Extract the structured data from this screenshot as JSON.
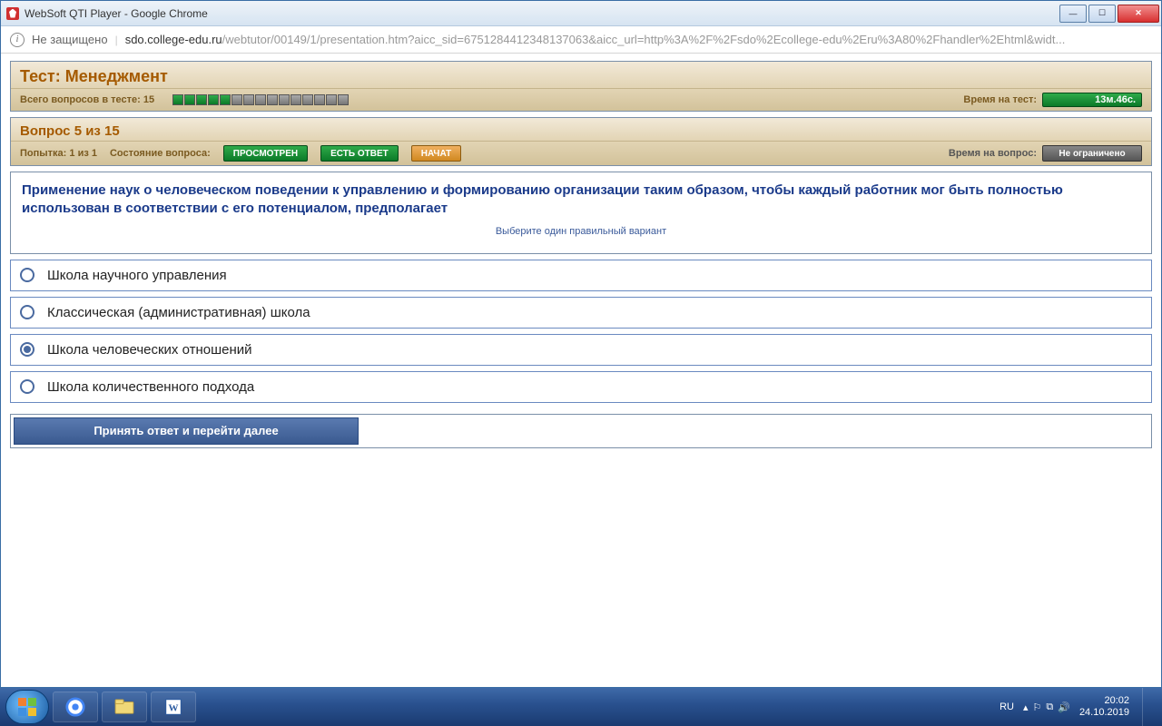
{
  "window": {
    "title": "WebSoft QTI Player - Google Chrome"
  },
  "address": {
    "not_secure": "Не защищено",
    "host": "sdo.college-edu.ru",
    "path": "/webtutor/00149/1/presentation.htm?aicc_sid=6751284412348137063&aicc_url=http%3A%2F%2Fsdo%2Ecollege-edu%2Eru%3A80%2Fhandler%2Ehtml&widt..."
  },
  "test": {
    "title": "Тест: Менеджмент",
    "total_label": "Всего вопросов в тесте: 15",
    "progress_done": 5,
    "progress_total": 15,
    "time_label": "Время на тест:",
    "time_value": "13м.46с."
  },
  "question_header": {
    "title": "Вопрос 5 из 15",
    "attempt": "Попытка: 1 из 1",
    "status_label": "Состояние вопроса:",
    "chips": {
      "viewed": "ПРОСМОТРЕН",
      "answered": "ЕСТЬ ОТВЕТ",
      "started": "НАЧАТ"
    },
    "time_label": "Время на вопрос:",
    "time_value": "Не ограничено"
  },
  "question": {
    "text": "Применение наук о человеческом поведении к управлению и формированию организации таким образом, чтобы каждый работник мог быть полностью использован в соответствии с его потенциалом, предполагает",
    "hint": "Выберите один правильный вариант",
    "answers": [
      "Школа научного управления",
      "Классическая (административная) школа",
      "Школа человеческих отношений",
      "Школа количественного подхода"
    ],
    "selected_index": 2
  },
  "buttons": {
    "submit": "Принять ответ и перейти далее"
  },
  "tray": {
    "lang": "RU",
    "time": "20:02",
    "date": "24.10.2019"
  }
}
